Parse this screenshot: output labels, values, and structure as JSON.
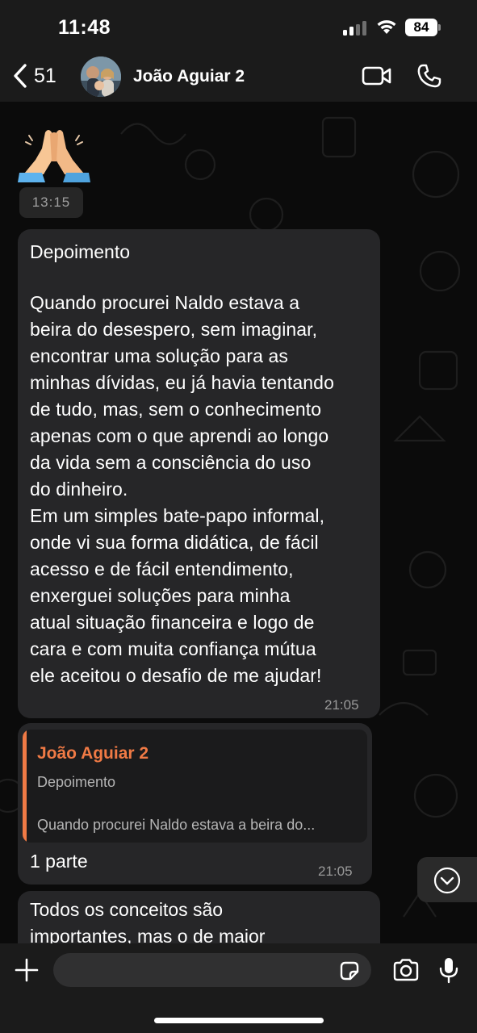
{
  "status_bar": {
    "time": "11:48",
    "battery": "84"
  },
  "header": {
    "back_count": "51",
    "contact_name": "João Aguiar 2"
  },
  "messages": {
    "sticker": {
      "emoji": "🙏",
      "time": "13:15"
    },
    "testimonial": {
      "title": "Depoimento",
      "lines": [
        "Quando procurei Naldo estava a",
        "beira do desespero, sem imaginar,",
        "encontrar uma solução para as",
        "minhas dívidas, eu já havia tentando",
        "de tudo, mas, sem o conhecimento",
        "apenas com o que aprendi ao longo",
        "da vida sem a consciência do uso",
        "do dinheiro.",
        "Em um simples bate-papo informal,",
        "onde vi sua forma didática, de fácil",
        "acesso e de fácil entendimento,",
        "enxerguei soluções para minha",
        "atual situação financeira e logo de",
        "cara e com muita confiança mútua",
        "ele aceitou o desafio de me ajudar!"
      ],
      "time": "21:05"
    },
    "reply": {
      "quote_author": "João Aguiar 2",
      "quote_title": "Depoimento",
      "quote_preview": "Quando procurei Naldo estava a beira do...",
      "text": "1 parte",
      "time": "21:05"
    },
    "partial": {
      "lines": [
        "Todos os conceitos são",
        "importantes, mas o de maior"
      ]
    }
  },
  "composer": {
    "placeholder": ""
  },
  "colors": {
    "accent_quote": "#f07a45",
    "bubble": "#262628",
    "bar": "#1b1b1b"
  },
  "icons": [
    "back-chevron-icon",
    "video-call-icon",
    "phone-icon",
    "chevron-down-icon",
    "plus-icon",
    "sticker-icon",
    "camera-icon",
    "microphone-icon"
  ]
}
